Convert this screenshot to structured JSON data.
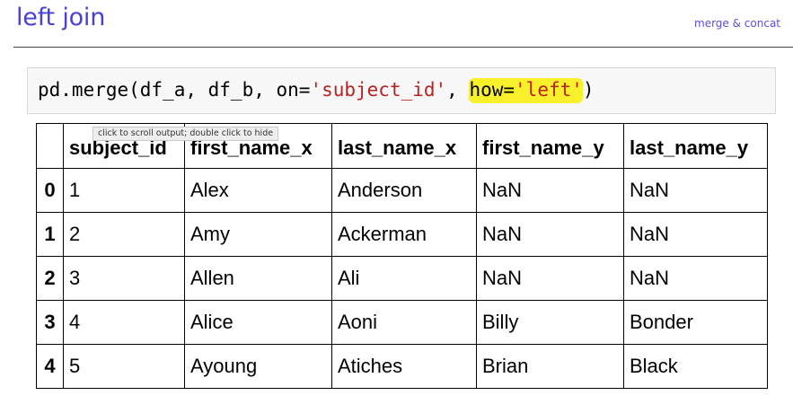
{
  "header": {
    "title": "left join",
    "section": "merge & concat"
  },
  "code_cell": {
    "code_prefix": "pd.merge(df_a, df_b, on=",
    "on_value": "'subject_id'",
    "separator": ", ",
    "how_keyword": "how=",
    "how_value": "'left'",
    "code_suffix": ")",
    "highlight_color": "#f7f02b"
  },
  "tooltip": {
    "text": "click to scroll output; double click to hide"
  },
  "table": {
    "columns": [
      "",
      "subject_id",
      "first_name_x",
      "last_name_x",
      "first_name_y",
      "last_name_y"
    ],
    "rows": [
      {
        "index": "0",
        "cells": [
          "1",
          "Alex",
          "Anderson",
          "NaN",
          "NaN"
        ]
      },
      {
        "index": "1",
        "cells": [
          "2",
          "Amy",
          "Ackerman",
          "NaN",
          "NaN"
        ]
      },
      {
        "index": "2",
        "cells": [
          "3",
          "Allen",
          "Ali",
          "NaN",
          "NaN"
        ]
      },
      {
        "index": "3",
        "cells": [
          "4",
          "Alice",
          "Aoni",
          "Billy",
          "Bonder"
        ]
      },
      {
        "index": "4",
        "cells": [
          "5",
          "Ayoung",
          "Atiches",
          "Brian",
          "Black"
        ]
      }
    ]
  }
}
